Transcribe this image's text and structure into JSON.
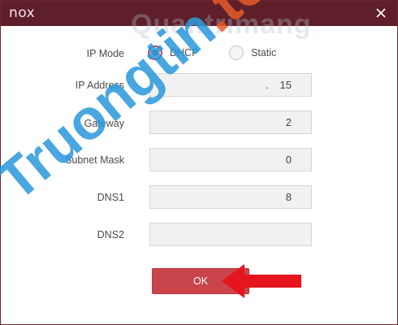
{
  "window": {
    "logo": "nox",
    "close_label": "×"
  },
  "form": {
    "ip_mode_label": "IP Mode",
    "ip_mode_options": [
      {
        "label": "DHCP",
        "checked": true
      },
      {
        "label": "Static",
        "checked": false
      }
    ],
    "ip_address_label": "IP Address",
    "ip_address_prefix": ".",
    "ip_address_value": "15",
    "gateway_label": "Gateway",
    "gateway_value": "2",
    "subnet_mask_label": "Subnet Mask",
    "subnet_mask_value": "0",
    "dns1_label": "DNS1",
    "dns1_value": "8",
    "dns2_label": "DNS2",
    "dns2_value": ""
  },
  "actions": {
    "ok_label": "OK"
  },
  "watermarks": {
    "top": "Quantrimang",
    "diagonal_main": "Truongtin",
    "diagonal_tld": ".top"
  },
  "colors": {
    "titlebar": "#5e1f2a",
    "accent": "#c5424a",
    "button": "#c9444b",
    "arrow": "#e5151e"
  }
}
